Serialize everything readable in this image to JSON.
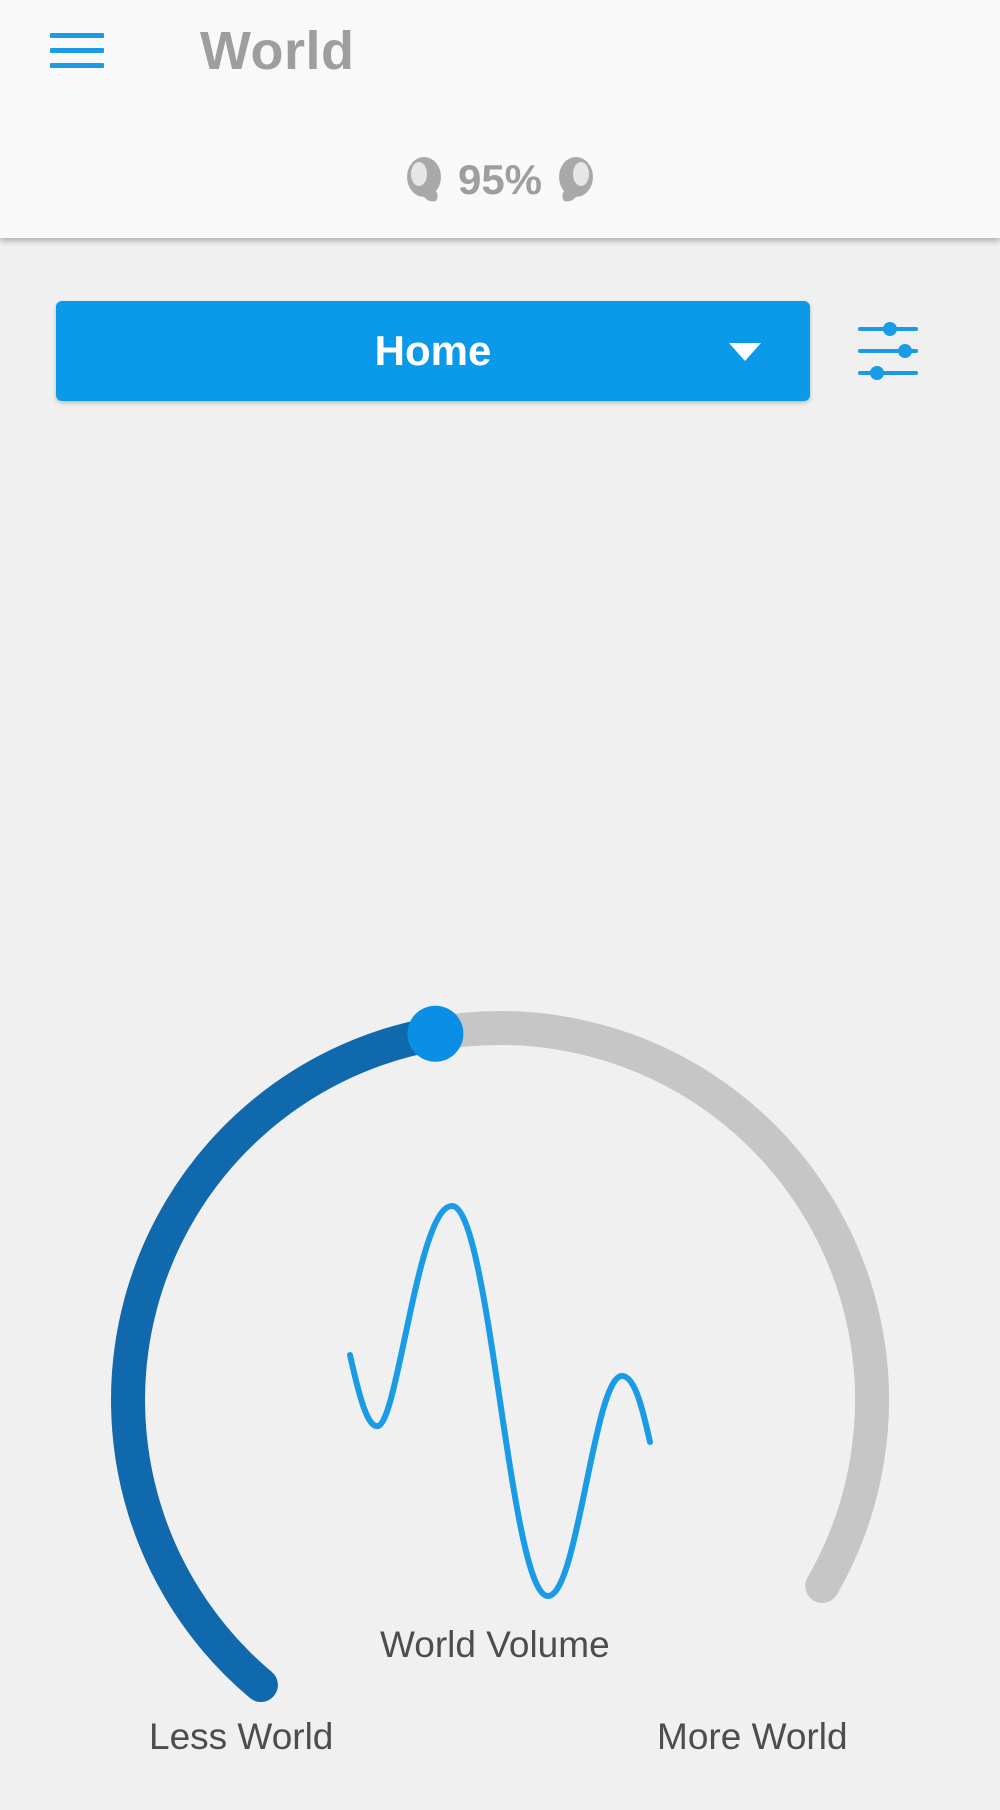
{
  "header": {
    "title": "World",
    "menu_icon": "hamburger-menu-icon"
  },
  "battery": {
    "level_text": "95%",
    "left_earbud_icon": "left-earbud-icon",
    "right_earbud_icon": "right-earbud-icon"
  },
  "mode_selector": {
    "selected": "Home",
    "caret_icon": "dropdown-arrow-icon"
  },
  "equalizer_button": {
    "icon": "sliders-icon"
  },
  "volume_dial": {
    "label": "World Volume",
    "min_label": "Less World",
    "max_label": "More World",
    "level": 0.5,
    "center_icon": "sound-wave-icon"
  },
  "colors": {
    "accent": "#0b99e9",
    "dial_active": "#1068ad",
    "dial_track": "#c6c6c6",
    "wave": "#1a9be6",
    "header_text": "#9e9e9e",
    "background": "#f0f0f0"
  }
}
